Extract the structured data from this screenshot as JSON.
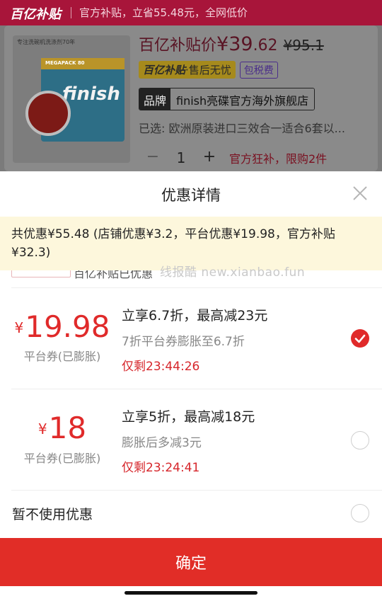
{
  "top_bar": {
    "logo_text": "百亿补贴",
    "subsidy_text": "官方补贴，立省55.48元，全网低价"
  },
  "product": {
    "image_brand_line": "专注洗碗机洗涤剂70年",
    "image_pack_label": "MEGAPACK 80",
    "image_brand": "finish",
    "price_prefix": "百亿补贴价",
    "price_main": "¥39",
    "price_decimal": ".62",
    "price_original": "¥95.1",
    "tag_logo": "百亿补贴",
    "tag_text": "·售后无忧",
    "tag_tax": "包税费",
    "store_label": "品牌",
    "store_name": "finish亮碟官方海外旗舰店",
    "selected": "已选: 欧洲原装进口三效合一适合6套以...",
    "qty_minus": "−",
    "quantity": "1",
    "qty_plus": "+",
    "qty_note": "官方狂补，限购2件"
  },
  "sheet": {
    "title": "优惠详情",
    "notice": "共优惠¥55.48 (店铺优惠¥3.2，平台优惠¥19.98，官方补贴¥32.3)",
    "peek_text": "百亿补贴已优惠",
    "watermark": "线报酷 new.xianbao.fun",
    "coupons": [
      {
        "currency": "¥",
        "amount": "19.98",
        "type": "平台券(已膨胀)",
        "title": "立享6.7折，最高减23元",
        "desc": "7折平台券膨胀至6.7折",
        "time_left": "仅剩23:44:26",
        "selected": true
      },
      {
        "currency": "¥",
        "amount": "18",
        "type": "平台券(已膨胀)",
        "title": "立享5折，最高减18元",
        "desc": "膨胀后多减3元",
        "time_left": "仅剩23:24:41",
        "selected": false
      }
    ],
    "no_use_label": "暂不使用优惠",
    "confirm_label": "确定"
  },
  "colors": {
    "accent": "#e12d27",
    "notice_bg": "#fdf7dc",
    "top_bar": "#a8153a"
  },
  "icons": [
    "close-icon",
    "checkmark-icon"
  ]
}
